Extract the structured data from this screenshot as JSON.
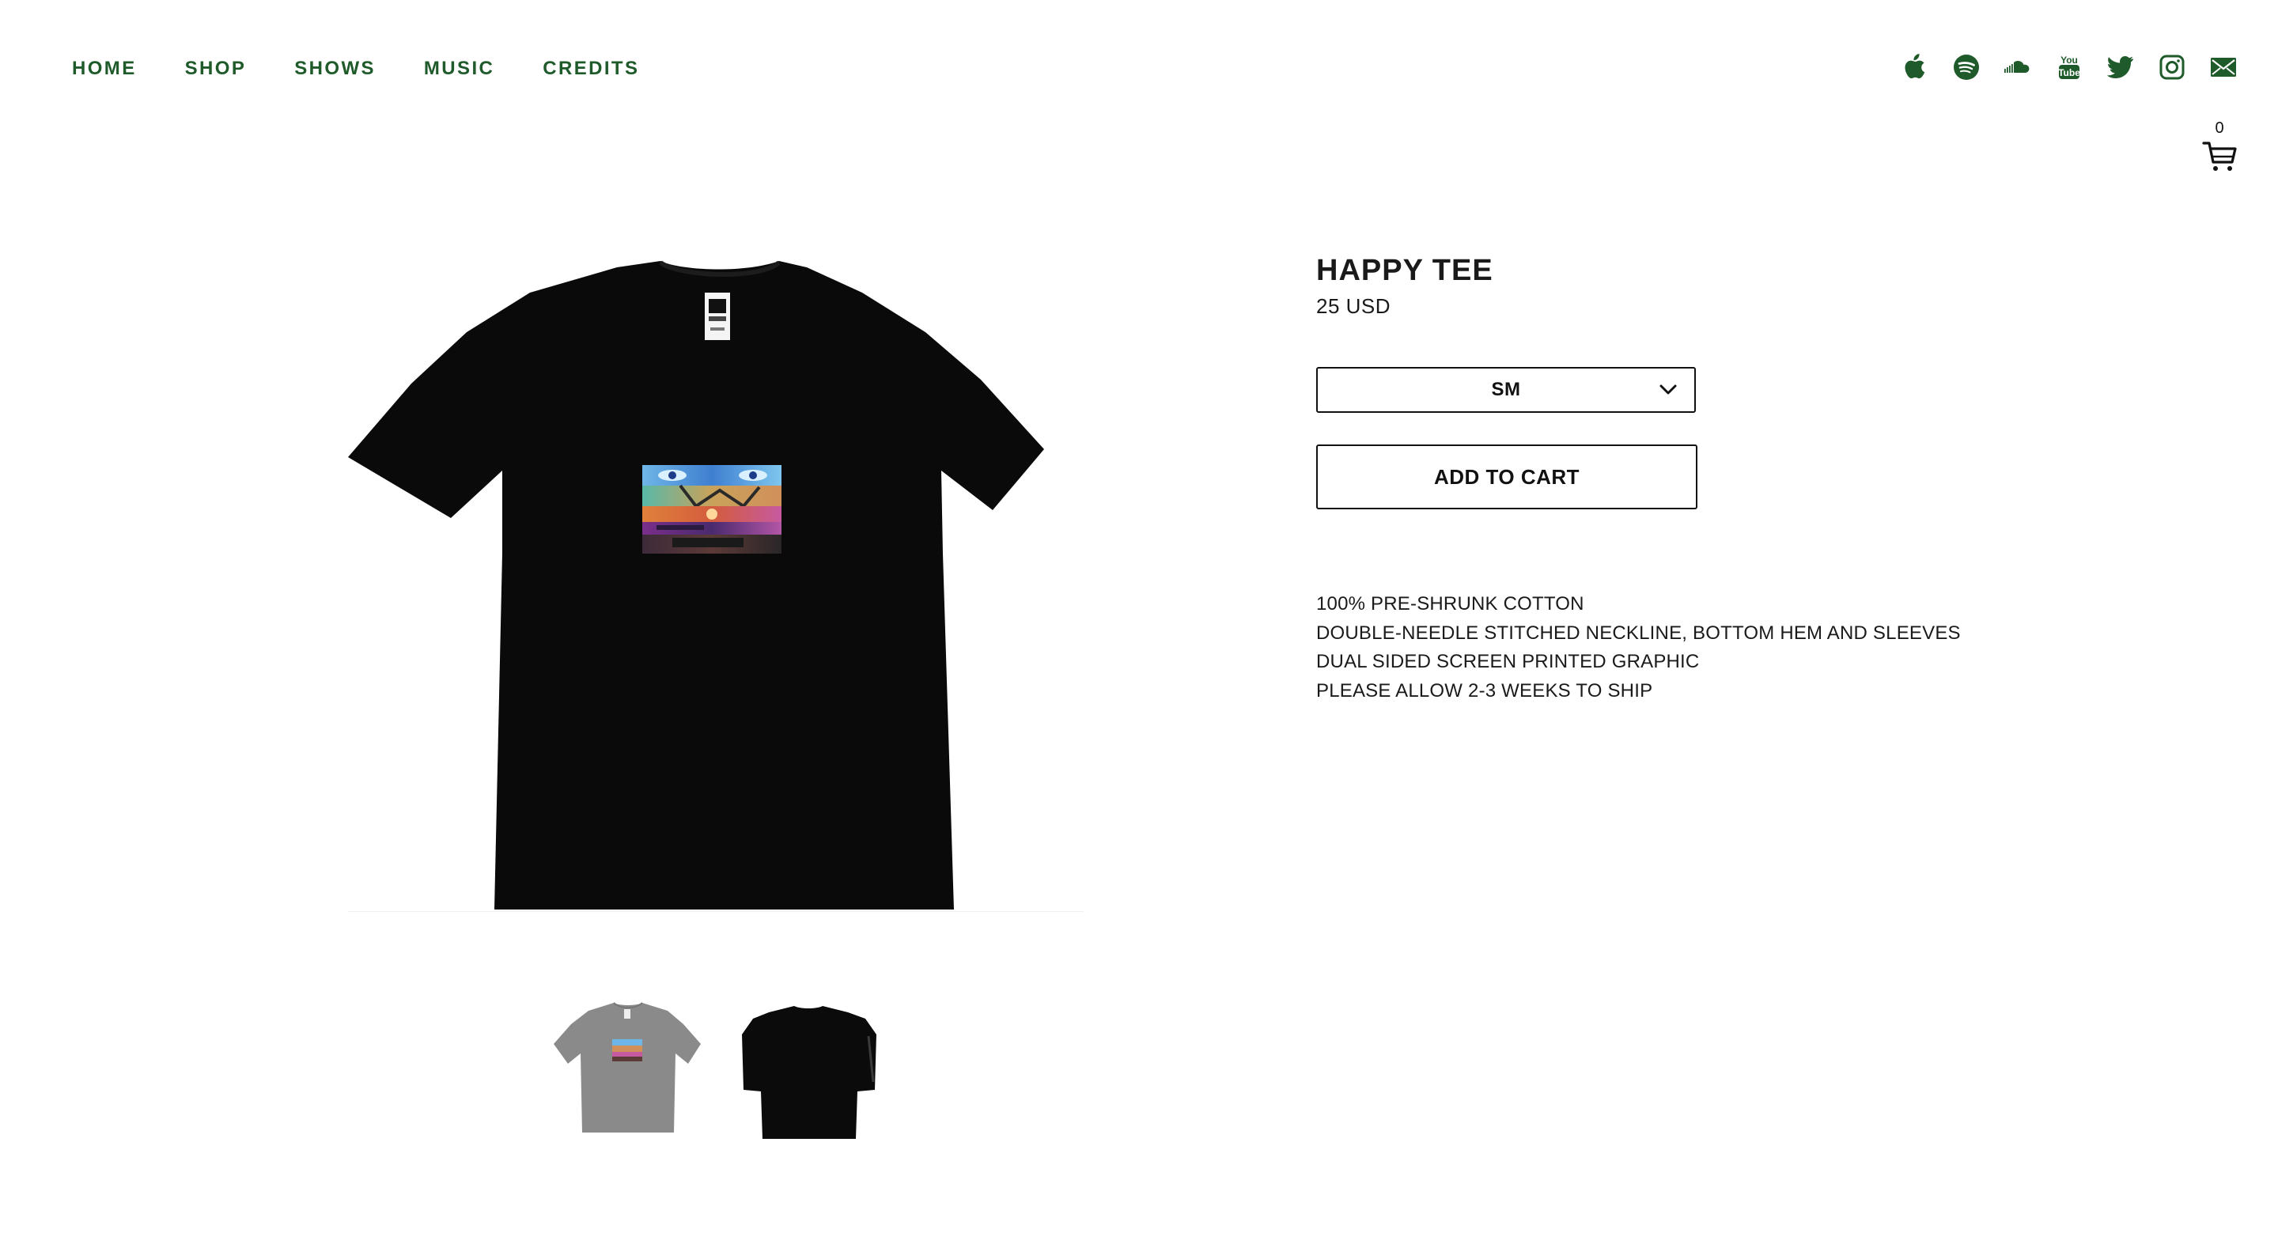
{
  "nav": {
    "items": [
      {
        "label": "HOME"
      },
      {
        "label": "SHOP"
      },
      {
        "label": "SHOWS"
      },
      {
        "label": "MUSIC"
      },
      {
        "label": "CREDITS"
      }
    ],
    "color": "#1e5a2a"
  },
  "social": {
    "icons": [
      "apple-music-icon",
      "spotify-icon",
      "soundcloud-icon",
      "youtube-icon",
      "twitter-icon",
      "instagram-icon",
      "mail-icon"
    ],
    "color": "#1e5a2a"
  },
  "cart": {
    "count": "0",
    "icon": "cart-icon"
  },
  "product": {
    "title": "HAPPY TEE",
    "price": "25 USD",
    "size_selected": "SM",
    "add_to_cart_label": "ADD TO CART",
    "details": [
      "100% PRE-SHRUNK COTTON",
      "DOUBLE-NEEDLE STITCHED NECKLINE, BOTTOM HEM AND SLEEVES",
      "DUAL SIDED SCREEN PRINTED GRAPHIC",
      "PLEASE ALLOW 2-3 WEEKS TO SHIP"
    ]
  },
  "thumbnails": [
    {
      "name": "grey-tee-front",
      "color": "#8a8a8a"
    },
    {
      "name": "black-tee-back",
      "color": "#0b0b0b"
    }
  ]
}
